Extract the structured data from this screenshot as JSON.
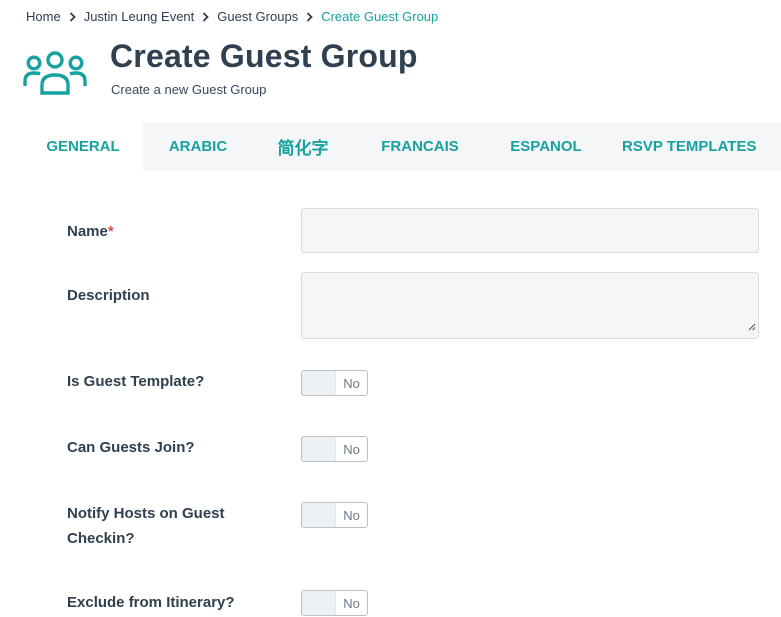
{
  "breadcrumb": {
    "items": [
      "Home",
      "Justin Leung Event",
      "Guest Groups"
    ],
    "current": "Create Guest Group"
  },
  "header": {
    "icon": "users-icon",
    "title": "Create Guest Group",
    "subtitle": "Create a new Guest Group"
  },
  "tabs": [
    "GENERAL",
    "ARABIC",
    "简化字",
    "FRANCAIS",
    "ESPANOL",
    "RSVP TEMPLATES"
  ],
  "active_tab": "GENERAL",
  "form": {
    "name": {
      "label": "Name",
      "required_marker": "*",
      "value": ""
    },
    "description": {
      "label": "Description",
      "value": ""
    },
    "is_guest_template": {
      "label": "Is Guest Template?",
      "value": "No"
    },
    "can_guests_join": {
      "label": "Can Guests Join?",
      "value": "No"
    },
    "notify_hosts": {
      "label_line1": "Notify Hosts on Guest",
      "label_line2": "Checkin?",
      "value": "No"
    },
    "exclude_itinerary": {
      "label": "Exclude from Itinerary?",
      "value": "No"
    }
  },
  "colors": {
    "accent": "#17a2a2",
    "title": "#2f4050",
    "required": "#d9534f",
    "panel_background": "#f4f6f8"
  }
}
